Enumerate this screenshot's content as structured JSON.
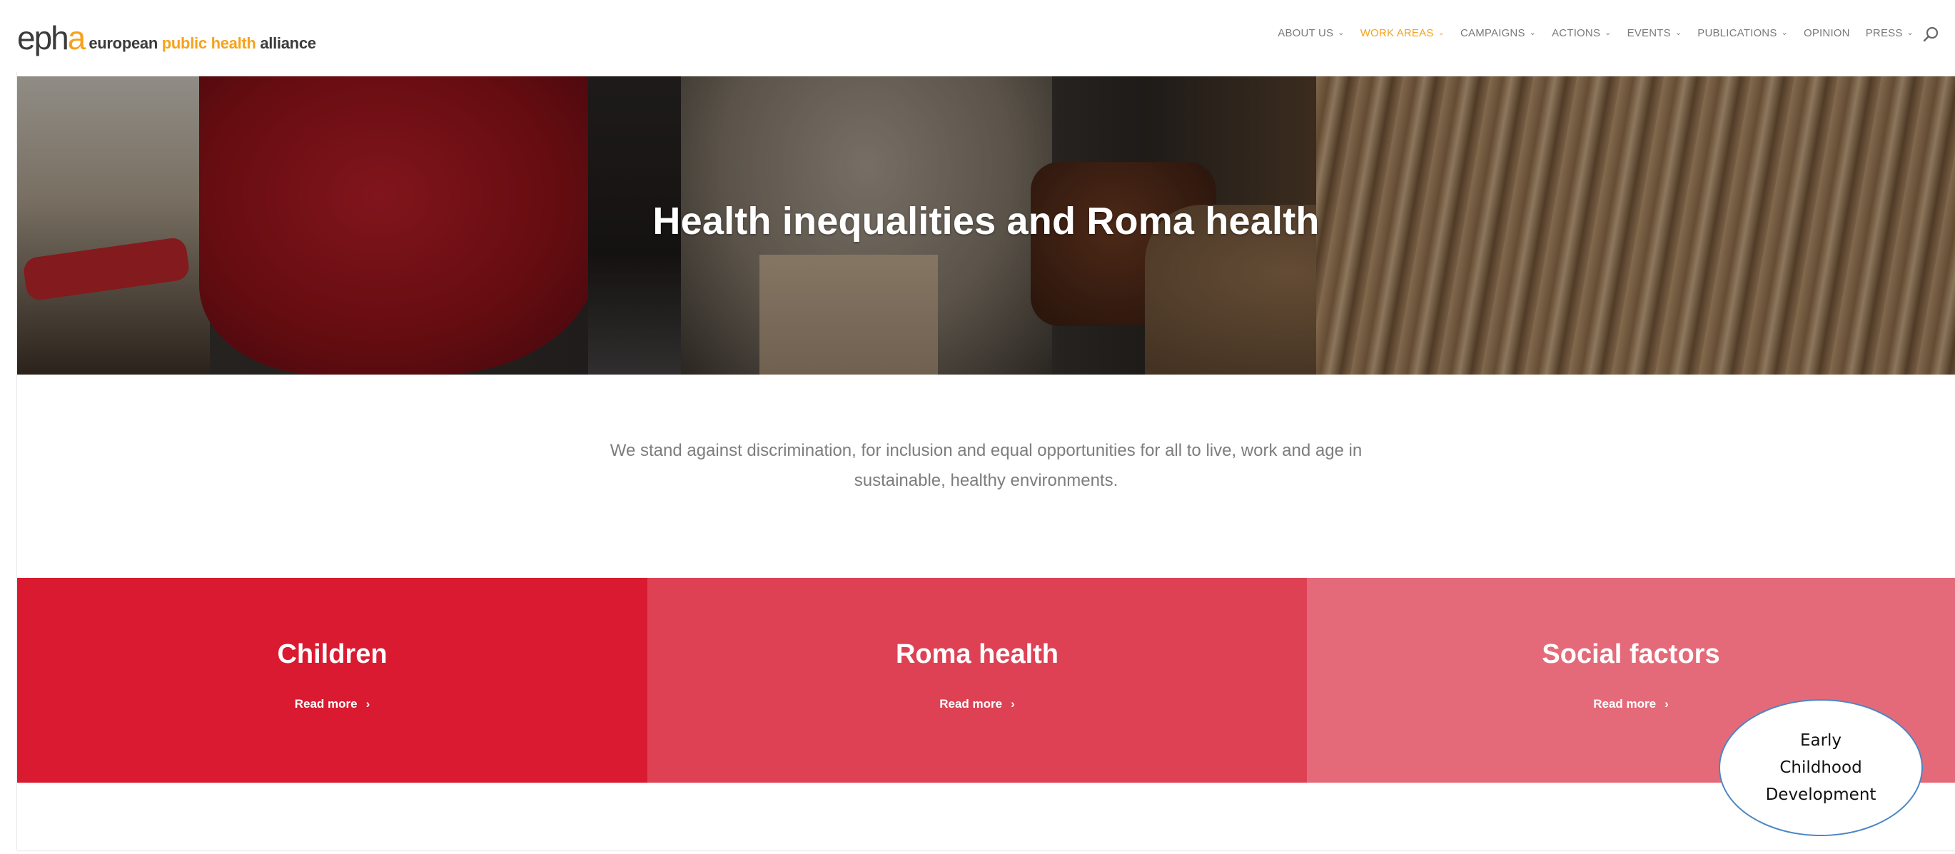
{
  "logo": {
    "mark_main": "eph",
    "mark_accent": "a",
    "word_1": "european ",
    "word_2": "public health ",
    "word_3": "alliance"
  },
  "nav": {
    "items": [
      {
        "label": "ABOUT US",
        "has_dropdown": true,
        "active": false
      },
      {
        "label": "WORK AREAS",
        "has_dropdown": true,
        "active": true
      },
      {
        "label": "CAMPAIGNS",
        "has_dropdown": true,
        "active": false
      },
      {
        "label": "ACTIONS",
        "has_dropdown": true,
        "active": false
      },
      {
        "label": "EVENTS",
        "has_dropdown": true,
        "active": false
      },
      {
        "label": "PUBLICATIONS",
        "has_dropdown": true,
        "active": false
      },
      {
        "label": "OPINION",
        "has_dropdown": false,
        "active": false
      },
      {
        "label": "PRESS",
        "has_dropdown": true,
        "active": false
      }
    ],
    "chevron": "⌄",
    "search_icon": "search-icon",
    "accent_color": "#f7a21b"
  },
  "hero": {
    "title": "Health inequalities and Roma health"
  },
  "intro": {
    "line_1": "We stand against discrimination, for inclusion and equal opportunities for all to live, work and age in",
    "line_2": "sustainable, healthy environments."
  },
  "tiles": [
    {
      "title": "Children",
      "link": "Read more",
      "color": "#d91a30"
    },
    {
      "title": "Roma health",
      "link": "Read more",
      "color": "#de4154"
    },
    {
      "title": "Social factors",
      "link": "Read more",
      "color": "#e56a79"
    }
  ],
  "link_chevron": "›",
  "callout": {
    "line_1": "Early",
    "line_2": "Childhood",
    "line_3": "Development"
  }
}
